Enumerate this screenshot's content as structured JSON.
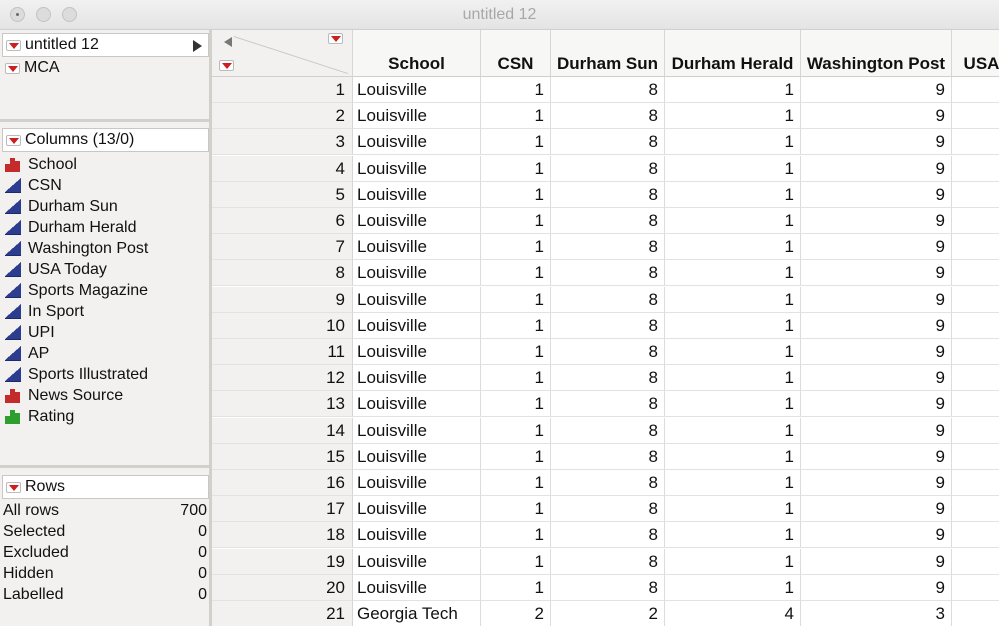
{
  "window": {
    "title": "untitled 12"
  },
  "tables_panel": {
    "table_name": "untitled 12",
    "script_name": "MCA"
  },
  "columns_panel": {
    "header": "Columns (13/0)",
    "items": [
      {
        "label": "School",
        "icon": "nominal-icon"
      },
      {
        "label": "CSN",
        "icon": "continuous-icon"
      },
      {
        "label": "Durham Sun",
        "icon": "continuous-icon"
      },
      {
        "label": "Durham Herald",
        "icon": "continuous-icon"
      },
      {
        "label": "Washington Post",
        "icon": "continuous-icon"
      },
      {
        "label": "USA Today",
        "icon": "continuous-icon"
      },
      {
        "label": "Sports Magazine",
        "icon": "continuous-icon"
      },
      {
        "label": "In Sport",
        "icon": "continuous-icon"
      },
      {
        "label": "UPI",
        "icon": "continuous-icon"
      },
      {
        "label": "AP",
        "icon": "continuous-icon"
      },
      {
        "label": "Sports Illustrated",
        "icon": "continuous-icon"
      },
      {
        "label": "News Source",
        "icon": "nominal-icon"
      },
      {
        "label": "Rating",
        "icon": "ordinal-icon"
      }
    ]
  },
  "rows_panel": {
    "header": "Rows",
    "stats": [
      {
        "label": "All rows",
        "value": "700"
      },
      {
        "label": "Selected",
        "value": "0"
      },
      {
        "label": "Excluded",
        "value": "0"
      },
      {
        "label": "Hidden",
        "value": "0"
      },
      {
        "label": "Labelled",
        "value": "0"
      }
    ]
  },
  "table": {
    "headers": [
      "School",
      "CSN",
      "Durham Sun",
      "Durham Herald",
      "Washington Post",
      "USA"
    ],
    "rows": [
      [
        "1",
        "Louisville",
        "1",
        "8",
        "1",
        "9",
        ""
      ],
      [
        "2",
        "Louisville",
        "1",
        "8",
        "1",
        "9",
        ""
      ],
      [
        "3",
        "Louisville",
        "1",
        "8",
        "1",
        "9",
        ""
      ],
      [
        "4",
        "Louisville",
        "1",
        "8",
        "1",
        "9",
        ""
      ],
      [
        "5",
        "Louisville",
        "1",
        "8",
        "1",
        "9",
        ""
      ],
      [
        "6",
        "Louisville",
        "1",
        "8",
        "1",
        "9",
        ""
      ],
      [
        "7",
        "Louisville",
        "1",
        "8",
        "1",
        "9",
        ""
      ],
      [
        "8",
        "Louisville",
        "1",
        "8",
        "1",
        "9",
        ""
      ],
      [
        "9",
        "Louisville",
        "1",
        "8",
        "1",
        "9",
        ""
      ],
      [
        "10",
        "Louisville",
        "1",
        "8",
        "1",
        "9",
        ""
      ],
      [
        "11",
        "Louisville",
        "1",
        "8",
        "1",
        "9",
        ""
      ],
      [
        "12",
        "Louisville",
        "1",
        "8",
        "1",
        "9",
        ""
      ],
      [
        "13",
        "Louisville",
        "1",
        "8",
        "1",
        "9",
        ""
      ],
      [
        "14",
        "Louisville",
        "1",
        "8",
        "1",
        "9",
        ""
      ],
      [
        "15",
        "Louisville",
        "1",
        "8",
        "1",
        "9",
        ""
      ],
      [
        "16",
        "Louisville",
        "1",
        "8",
        "1",
        "9",
        ""
      ],
      [
        "17",
        "Louisville",
        "1",
        "8",
        "1",
        "9",
        ""
      ],
      [
        "18",
        "Louisville",
        "1",
        "8",
        "1",
        "9",
        ""
      ],
      [
        "19",
        "Louisville",
        "1",
        "8",
        "1",
        "9",
        ""
      ],
      [
        "20",
        "Louisville",
        "1",
        "8",
        "1",
        "9",
        ""
      ],
      [
        "21",
        "Georgia Tech",
        "2",
        "2",
        "4",
        "3",
        ""
      ]
    ]
  }
}
